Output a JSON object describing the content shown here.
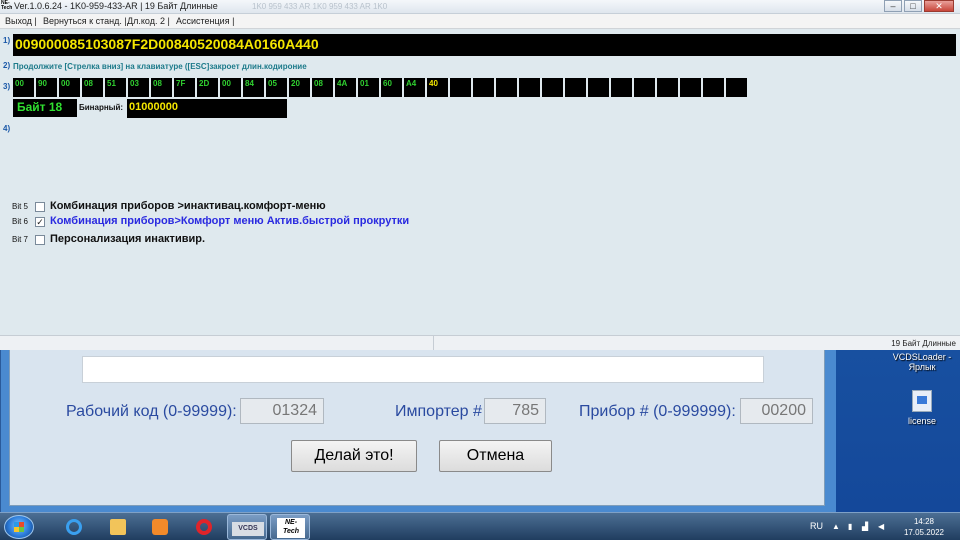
{
  "app": {
    "title": "Ver.1.0.6.24 - 1K0-959-433-AR | 19 Байт Длинные",
    "title_ghost": "1K0 959 433 AR 1K0 959 433 AR 1K0",
    "logo": "NE-Tech",
    "menu": [
      "Выход |",
      "Вернуться к станд. |",
      "Дл.код. 2 |",
      "Ассистенция |"
    ],
    "section_labels": [
      "1)",
      "2)",
      "3)",
      "4)"
    ],
    "long_code": "009000085103087F2D00840520084A0160A440",
    "hint": "Продолжите [Стрелка вниз] на клавиатуре ([ESC]закроет длин.кодироние",
    "bytes": [
      "00",
      "90",
      "00",
      "08",
      "51",
      "03",
      "08",
      "7F",
      "2D",
      "00",
      "84",
      "05",
      "20",
      "08",
      "4A",
      "01",
      "60",
      "A4",
      "40",
      "",
      "",
      "",
      "",
      "",
      "",
      "",
      "",
      "",
      "",
      "",
      "",
      ""
    ],
    "selected_byte_index": 18,
    "byte_label": "Байт 18",
    "binary_label": "Бинарный:",
    "binary_value": "01000000",
    "bits": [
      {
        "label": "Bit 5",
        "checked": false,
        "text": "Комбинация приборов >инактивац.комфорт-меню",
        "active": false
      },
      {
        "label": "Bit 6",
        "checked": true,
        "text": "Комбинация приборов>Комфорт меню Актив.быстрой прокрутки",
        "active": true
      },
      {
        "label": "Bit 7",
        "checked": false,
        "text": "Персонализация инактивир.",
        "active": false
      }
    ],
    "status_text": "19 Байт Длинные"
  },
  "dialog": {
    "workshop_label": "Рабочий код (0-99999):",
    "workshop_value": "01324",
    "importer_label": "Импортер #",
    "importer_value": "785",
    "device_label": "Прибор # (0-999999):",
    "device_value": "00200",
    "ok_label": "Делай это!",
    "cancel_label": "Отмена"
  },
  "desktop": {
    "icons": [
      {
        "name": "VCDSLoader - Ярлык"
      },
      {
        "name": "license"
      }
    ]
  },
  "taskbar": {
    "vcds_label": "VCDS",
    "netech_label": "NE-Tech",
    "lang": "RU",
    "time": "14:28",
    "date": "17.05.2022"
  },
  "colors": {
    "code_yellow": "#f4e600",
    "byte_green": "#30d030",
    "active_bit_blue": "#2a2ae0",
    "label_blue": "#1a58a8"
  }
}
